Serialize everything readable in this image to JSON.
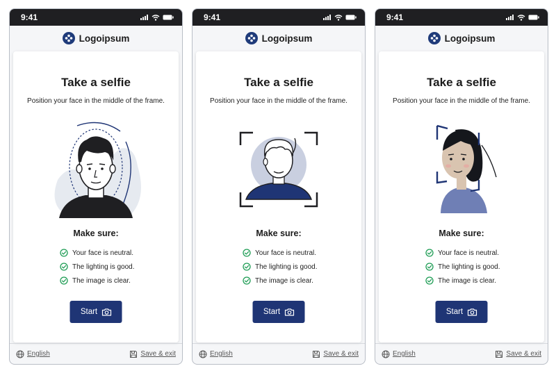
{
  "screens": [
    {
      "status": {
        "time": "9:41"
      },
      "brand": {
        "name": "Logoipsum"
      },
      "title": "Take a selfie",
      "subtitle": "Position your face in the middle of the frame.",
      "illustration": "man-face-oval-guide",
      "make_sure": {
        "heading": "Make sure:",
        "items": [
          "Your face is neutral.",
          "The lighting is good.",
          "The image is clear."
        ]
      },
      "start_button": {
        "label": "Start",
        "icon": "camera-icon"
      },
      "footer": {
        "language": "English",
        "save_exit": "Save & exit"
      }
    },
    {
      "status": {
        "time": "9:41"
      },
      "brand": {
        "name": "Logoipsum"
      },
      "title": "Take a selfie",
      "subtitle": "Position your face in the middle of the frame.",
      "illustration": "avatar-corner-frame",
      "make_sure": {
        "heading": "Make sure:",
        "items": [
          "Your face is neutral.",
          "The lighting is good.",
          "The image is clear."
        ]
      },
      "start_button": {
        "label": "Start",
        "icon": "camera-icon"
      },
      "footer": {
        "language": "English",
        "save_exit": "Save & exit"
      }
    },
    {
      "status": {
        "time": "9:41"
      },
      "brand": {
        "name": "Logoipsum"
      },
      "title": "Take a selfie",
      "subtitle": "Position your face in the middle of the frame.",
      "illustration": "woman-face-bracket-frame",
      "make_sure": {
        "heading": "Make sure:",
        "items": [
          "Your face is neutral.",
          "The lighting is good.",
          "The image is clear."
        ]
      },
      "start_button": {
        "label": "Start",
        "icon": "camera-icon"
      },
      "footer": {
        "language": "English",
        "save_exit": "Save & exit"
      }
    }
  ],
  "colors": {
    "primary": "#1f3575",
    "status_bar": "#1f1f22",
    "check": "#1f9d55",
    "avatar_circle": "#c9cfe0",
    "skin": "#d9c4b0"
  }
}
